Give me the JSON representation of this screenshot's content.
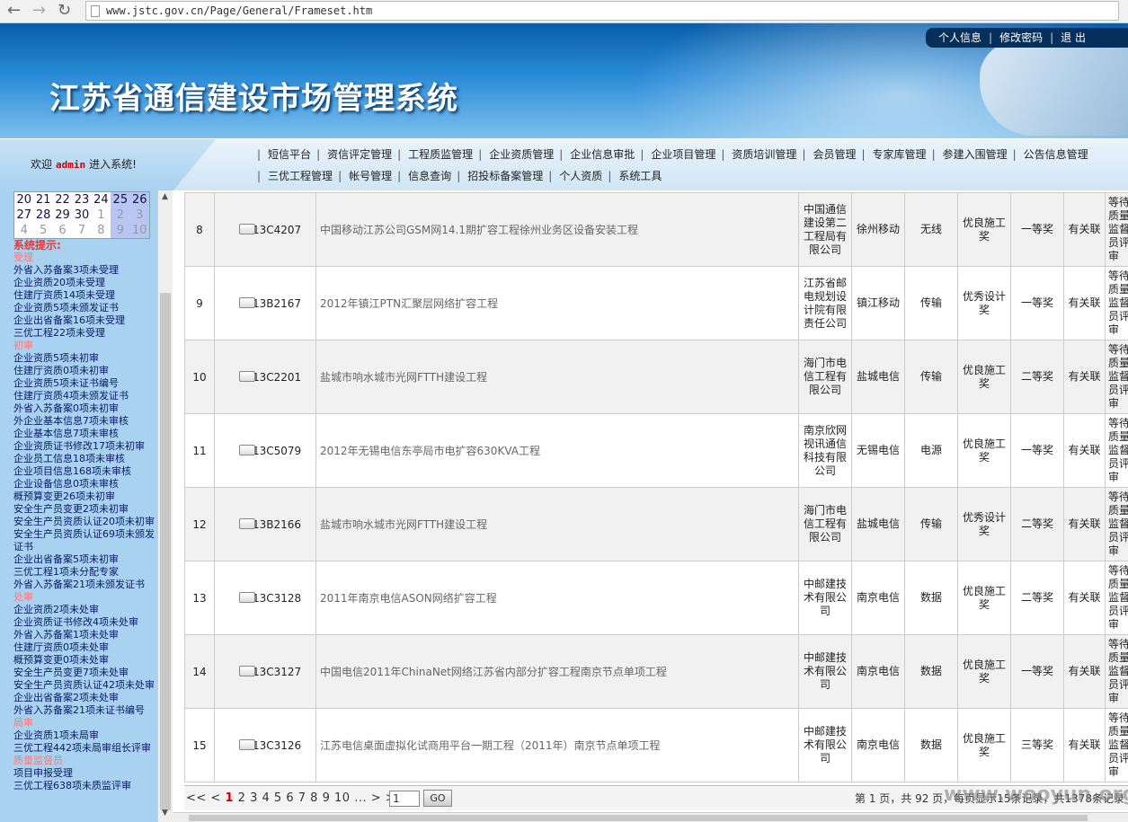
{
  "browser": {
    "url": "www.jstc.gov.cn/Page/General/Frameset.htm",
    "back_icon": "←",
    "forward_icon": "→",
    "reload_icon": "↻"
  },
  "header": {
    "system_name": "江苏省通信建设市场管理系统",
    "links": [
      "个人信息",
      "修改密码",
      "退 出"
    ]
  },
  "welcome": {
    "prefix": "欢迎",
    "user": "admin",
    "suffix": "进入系统!"
  },
  "nav": {
    "row1": [
      "短信平台",
      "资信评定管理",
      "工程质监管理",
      "企业资质管理",
      "企业信息审批",
      "企业项目管理",
      "资质培训管理",
      "会员管理",
      "专家库管理",
      "参建入围管理",
      "公告信息管理"
    ],
    "row2": [
      "三优工程管理",
      "帐号管理",
      "信息查询",
      "招投标备案管理",
      "个人资质",
      "系统工具"
    ]
  },
  "calendar": {
    "rows": [
      [
        "20",
        "21",
        "22",
        "23",
        "24",
        "25",
        "26"
      ],
      [
        "27",
        "28",
        "29",
        "30",
        "1",
        "2",
        "3"
      ],
      [
        "4",
        "5",
        "6",
        "7",
        "8",
        "9",
        "10"
      ]
    ]
  },
  "hints": {
    "title": "系统提示:",
    "sections": [
      {
        "name": "受理",
        "items": [
          "外省入苏备案3项未受理",
          "企业资质20项未受理",
          "住建厅资质14项未受理",
          "企业资质5项未颁发证书",
          "企业出省备案16项未受理",
          "三优工程22项未受理"
        ]
      },
      {
        "name": "初审",
        "items": [
          "企业资质5项未初审",
          "住建厅资质0项未初审",
          "企业资质5项未证书编号",
          "住建厅资质4项未颁发证书",
          "外省入苏备案0项未初审",
          "外企业基本信息7项未审核",
          "企业基本信息7项未审核",
          "企业资质证书修改17项未初审",
          "企业员工信息18项未审核",
          "企业项目信息168项未审核",
          "企业设备信息0项未审核",
          "概预算变更26项未初审",
          "安全生产员变更2项未初审",
          "安全生产员资质认证20项未初审",
          "安全生产员资质认证69项未颁发证书",
          "企业出省备案5项未初审",
          "三优工程1项未分配专家",
          "外省入苏备案21项未颁发证书"
        ]
      },
      {
        "name": "处审",
        "items": [
          "企业资质2项未处审",
          "企业资质证书修改4项未处审",
          "外省入苏备案1项未处审",
          "住建厅资质0项未处审",
          "概预算变更0项未处审",
          "安全生产员变更7项未处审",
          "安全生产员资质认证42项未处审",
          "企业出省备案2项未处审",
          "外省入苏备案21项未证书编号"
        ]
      },
      {
        "name": "局审",
        "items": [
          "企业资质1项未局审",
          "三优工程442项未局审组长评审"
        ]
      },
      {
        "name": "质量监督员",
        "items": [
          "项目申报受理",
          "三优工程638项未质监评审"
        ]
      }
    ]
  },
  "table": {
    "rows": [
      {
        "no": "8",
        "code": "13C4207",
        "name": "中国移动江苏公司GSM网14.1期扩容工程徐州业务区设备安装工程",
        "company": "中国通信建设第二工程局有限公司",
        "owner": "徐州移动",
        "category": "无线",
        "award": "优良施工奖",
        "grade": "一等奖",
        "dept": "有关联",
        "last": "等待质量监督员评审"
      },
      {
        "no": "9",
        "code": "13B2167",
        "name": "2012年镇江PTN汇聚层网络扩容工程",
        "company": "江苏省邮电规划设计院有限责任公司",
        "owner": "镇江移动",
        "category": "传输",
        "award": "优秀设计奖",
        "grade": "一等奖",
        "dept": "有关联",
        "last": "等待质量监督员评审"
      },
      {
        "no": "10",
        "code": "13C2201",
        "name": "盐城市响水城市光网FTTH建设工程",
        "company": "海门市电信工程有限公司",
        "owner": "盐城电信",
        "category": "传输",
        "award": "优良施工奖",
        "grade": "二等奖",
        "dept": "有关联",
        "last": "等待质量监督员评审"
      },
      {
        "no": "11",
        "code": "13C5079",
        "name": "2012年无锡电信东亭局市电扩容630KVA工程",
        "company": "南京欣网视讯通信科技有限公司",
        "owner": "无锡电信",
        "category": "电源",
        "award": "优良施工奖",
        "grade": "一等奖",
        "dept": "有关联",
        "last": "等待质量监督员评审"
      },
      {
        "no": "12",
        "code": "13B2166",
        "name": "盐城市响水城市光网FTTH建设工程",
        "company": "海门市电信工程有限公司",
        "owner": "盐城电信",
        "category": "传输",
        "award": "优秀设计奖",
        "grade": "二等奖",
        "dept": "有关联",
        "last": "等待质量监督员评审"
      },
      {
        "no": "13",
        "code": "13C3128",
        "name": "2011年南京电信ASON网络扩容工程",
        "company": "中邮建技术有限公司",
        "owner": "南京电信",
        "category": "数据",
        "award": "优良施工奖",
        "grade": "二等奖",
        "dept": "有关联",
        "last": "等待质量监督员评审"
      },
      {
        "no": "14",
        "code": "13C3127",
        "name": "中国电信2011年ChinaNet网络江苏省内部分扩容工程南京节点单项工程",
        "company": "中邮建技术有限公司",
        "owner": "南京电信",
        "category": "数据",
        "award": "优良施工奖",
        "grade": "一等奖",
        "dept": "有关联",
        "last": "等待质量监督员评审"
      },
      {
        "no": "15",
        "code": "13C3126",
        "name": "江苏电信桌面虚拟化试商用平台一期工程（2011年）南京节点单项工程",
        "company": "中邮建技术有限公司",
        "owner": "南京电信",
        "category": "数据",
        "award": "优良施工奖",
        "grade": "三等奖",
        "dept": "有关联",
        "last": "等待质量监督员评审"
      }
    ]
  },
  "pager": {
    "prev": "<< <",
    "pages": [
      "1",
      "2",
      "3",
      "4",
      "5",
      "6",
      "7",
      "8",
      "9",
      "10",
      "..."
    ],
    "current": "1",
    "next": "> >>",
    "input_value": "1",
    "go_label": "GO",
    "info": "第 1 页，共 92 页，每页显示15条记录，共1378条记录"
  },
  "watermark": "www.wooyun.org"
}
